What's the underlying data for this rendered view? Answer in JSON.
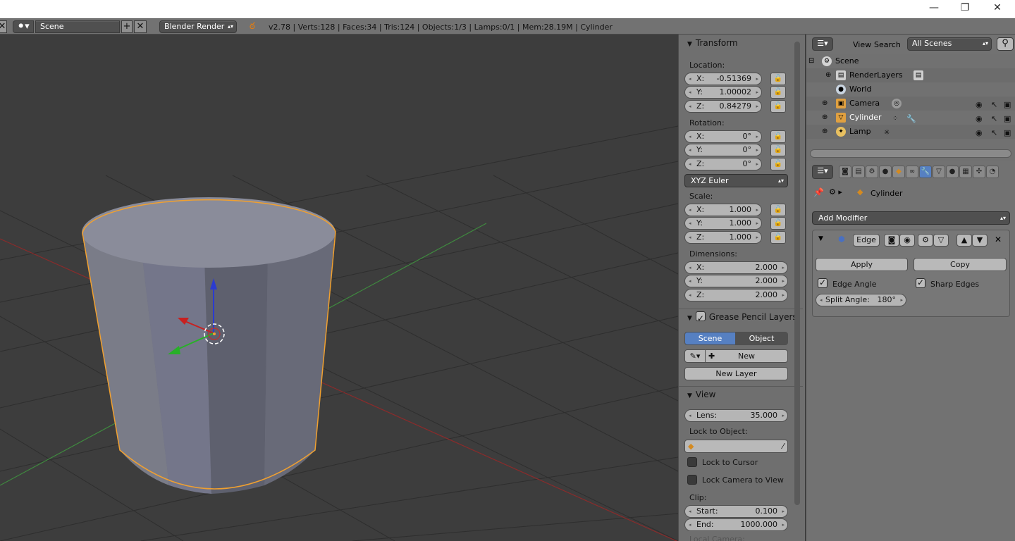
{
  "window": {
    "minimize": "—",
    "maximize": "❐",
    "close": "✕"
  },
  "topbar": {
    "scene_name": "Scene",
    "render_engine": "Blender Render",
    "info": "v2.78 | Verts:128 | Faces:34 | Tris:124 | Objects:1/3 | Lamps:0/1 | Mem:28.19M | Cylinder"
  },
  "npanel": {
    "transform": {
      "title": "Transform",
      "location_label": "Location:",
      "location": [
        {
          "axis": "X:",
          "value": "-0.51369"
        },
        {
          "axis": "Y:",
          "value": "1.00002"
        },
        {
          "axis": "Z:",
          "value": "0.84279"
        }
      ],
      "rotation_label": "Rotation:",
      "rotation": [
        {
          "axis": "X:",
          "value": "0°"
        },
        {
          "axis": "Y:",
          "value": "0°"
        },
        {
          "axis": "Z:",
          "value": "0°"
        }
      ],
      "rotation_mode": "XYZ Euler",
      "scale_label": "Scale:",
      "scale": [
        {
          "axis": "X:",
          "value": "1.000"
        },
        {
          "axis": "Y:",
          "value": "1.000"
        },
        {
          "axis": "Z:",
          "value": "1.000"
        }
      ],
      "dimensions_label": "Dimensions:",
      "dimensions": [
        {
          "axis": "X:",
          "value": "2.000"
        },
        {
          "axis": "Y:",
          "value": "2.000"
        },
        {
          "axis": "Z:",
          "value": "2.000"
        }
      ]
    },
    "grease": {
      "title": "Grease Pencil Layers",
      "tab_scene": "Scene",
      "tab_object": "Object",
      "new": "New",
      "new_layer": "New Layer"
    },
    "view": {
      "title": "View",
      "lens_label": "Lens:",
      "lens_value": "35.000",
      "lock_object_label": "Lock to Object:",
      "lock_cursor": "Lock to Cursor",
      "lock_camera": "Lock Camera to View",
      "clip_label": "Clip:",
      "clip_start_label": "Start:",
      "clip_start": "0.100",
      "clip_end_label": "End:",
      "clip_end": "1000.000",
      "local_camera": "Local Camera:"
    }
  },
  "outliner": {
    "view_menu": "View",
    "search_menu": "Search",
    "display_mode": "All Scenes",
    "items": [
      {
        "name": "Scene"
      },
      {
        "name": "RenderLayers"
      },
      {
        "name": "World"
      },
      {
        "name": "Camera"
      },
      {
        "name": "Cylinder"
      },
      {
        "name": "Lamp"
      }
    ]
  },
  "properties": {
    "breadcrumb_object": "Cylinder",
    "add_modifier": "Add Modifier",
    "modifier": {
      "name": "Edge",
      "apply": "Apply",
      "copy": "Copy",
      "edge_angle": "Edge Angle",
      "sharp_edges": "Sharp Edges",
      "split_angle_label": "Split Angle:",
      "split_angle_value": "180°"
    }
  },
  "colors": {
    "accent_blue": "#5680c2",
    "selection_orange": "#f0a030",
    "viewport_bg": "#3d3d3d"
  }
}
